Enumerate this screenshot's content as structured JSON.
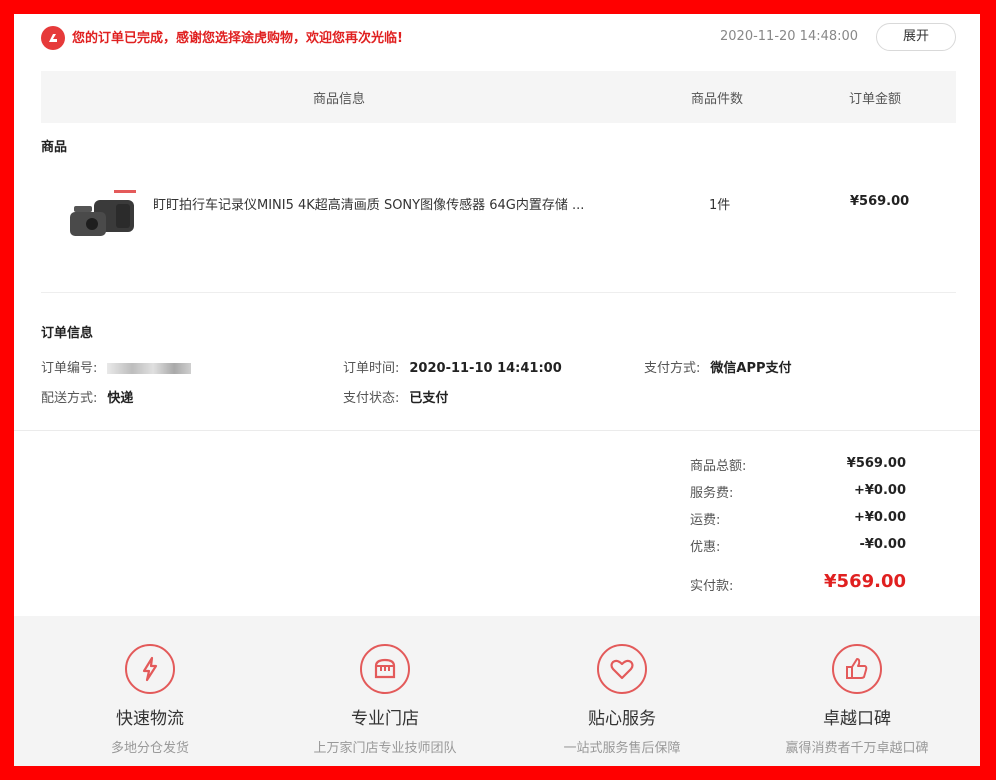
{
  "status": {
    "message": "您的订单已完成，感谢您选择途虎购物，欢迎您再次光临!",
    "time": "2020-11-20 14:48:00",
    "expand_label": "展开",
    "accent_color": "#e63a3a"
  },
  "table_header": {
    "info": "商品信息",
    "qty": "商品件数",
    "amount": "订单金额"
  },
  "products_section": {
    "title": "商品",
    "items": [
      {
        "name": "盯盯拍行车记录仪MINI5 4K超高清画质 SONY图像传感器 64G内置存储 ...",
        "qty": "1件",
        "amount": "¥569.00"
      }
    ]
  },
  "order_info": {
    "title": "订单信息",
    "order_no_label": "订单编号:",
    "order_time_label": "订单时间:",
    "order_time": "2020-11-10 14:41:00",
    "pay_method_label": "支付方式:",
    "pay_method": "微信APP支付",
    "delivery_label": "配送方式:",
    "delivery": "快递",
    "pay_status_label": "支付状态:",
    "pay_status": "已支付"
  },
  "summary": {
    "goods_total_label": "商品总额:",
    "goods_total": "¥569.00",
    "service_fee_label": "服务费:",
    "service_fee": "+¥0.00",
    "shipping_label": "运费:",
    "shipping": "+¥0.00",
    "discount_label": "优惠:",
    "discount": "-¥0.00",
    "paid_label": "实付款:",
    "paid": "¥569.00"
  },
  "features": [
    {
      "icon": "lightning-icon",
      "title": "快速物流",
      "desc": "多地分仓发货"
    },
    {
      "icon": "store-icon",
      "title": "专业门店",
      "desc": "上万家门店专业技师团队"
    },
    {
      "icon": "heart-icon",
      "title": "贴心服务",
      "desc": "一站式服务售后保障"
    },
    {
      "icon": "thumbs-up-icon",
      "title": "卓越口碑",
      "desc": "赢得消费者千万卓越口碑"
    }
  ]
}
